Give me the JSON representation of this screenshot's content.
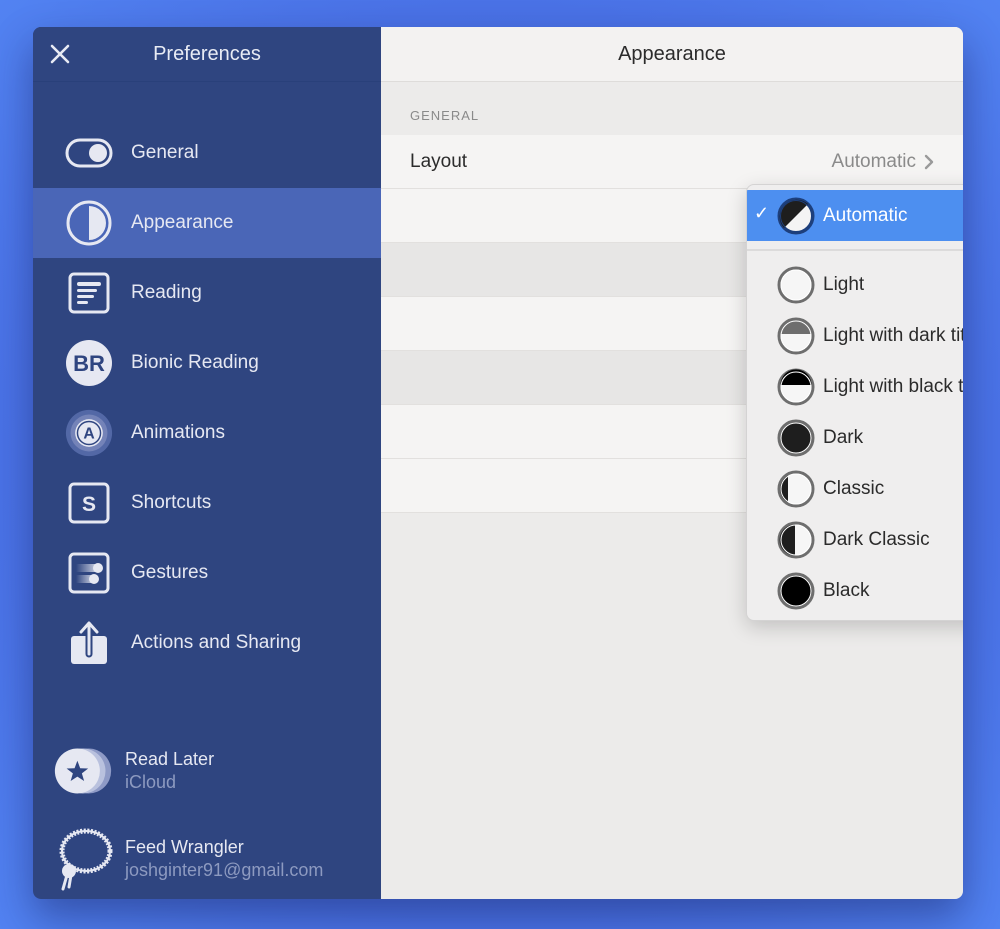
{
  "sidebar": {
    "title": "Preferences",
    "close_icon": "close-icon",
    "items": [
      {
        "label": "General",
        "icon": "toggle-icon",
        "active": false
      },
      {
        "label": "Appearance",
        "icon": "half-circle-icon",
        "active": true
      },
      {
        "label": "Reading",
        "icon": "text-lines-icon",
        "active": false
      },
      {
        "label": "Bionic Reading",
        "icon": "br-badge-icon",
        "active": false
      },
      {
        "label": "Animations",
        "icon": "animation-a-icon",
        "active": false
      },
      {
        "label": "Shortcuts",
        "icon": "s-key-icon",
        "active": false
      },
      {
        "label": "Gestures",
        "icon": "gesture-icon",
        "active": false
      },
      {
        "label": "Actions and Sharing",
        "icon": "share-icon",
        "active": false
      }
    ],
    "accounts": [
      {
        "name": "Read Later",
        "detail": "iCloud",
        "icon": "star-stack-icon"
      },
      {
        "name": "Feed Wrangler",
        "detail": "joshginter91@gmail.com",
        "icon": "lasso-icon"
      }
    ]
  },
  "main": {
    "title": "Appearance",
    "section": "GENERAL",
    "rows": [
      {
        "label": "Layout",
        "value": "Automatic",
        "icon": "chevron-right-icon"
      }
    ]
  },
  "dropdown": {
    "selected": "Automatic",
    "options": [
      {
        "label": "Automatic",
        "swatch": "automatic",
        "selected": true
      },
      {
        "label": "Light",
        "swatch": "light"
      },
      {
        "label": "Light with dark titlebar",
        "swatch": "light-dark-titlebar"
      },
      {
        "label": "Light with black titlebar",
        "swatch": "light-black-titlebar"
      },
      {
        "label": "Dark",
        "swatch": "dark"
      },
      {
        "label": "Classic",
        "swatch": "classic"
      },
      {
        "label": "Dark Classic",
        "swatch": "dark-classic"
      },
      {
        "label": "Black",
        "swatch": "black"
      }
    ],
    "check_glyph": "✓"
  },
  "colors": {
    "sidebar_bg": "#2f4580",
    "sidebar_active": "#4a66b7",
    "selection_blue": "#4d8ff0",
    "desktop_blue": "#4a72e6"
  }
}
